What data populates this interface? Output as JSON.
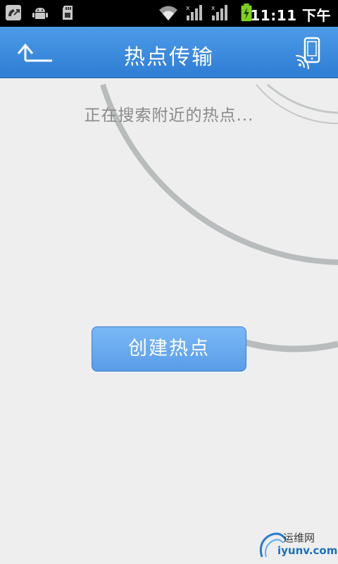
{
  "status_bar": {
    "time": "11:11 下午",
    "icons": [
      "missed-call-icon",
      "android-debug-icon",
      "sd-card-icon",
      "wifi-icon",
      "signal-icon",
      "signal-icon",
      "battery-charging-icon"
    ]
  },
  "header": {
    "title": "热点传输",
    "back_icon": "back-arrow-icon",
    "phone_icon": "phone-connect-icon",
    "background_color": "#3a8ade"
  },
  "main": {
    "status_text": "正在搜索附近的热点...",
    "create_button_label": "创建热点"
  },
  "watermark": {
    "line1": "运维网",
    "line2": "iyunv.com"
  },
  "colors": {
    "accent": "#5a9de8",
    "background": "#eeeeee",
    "status_text": "#8a8a8a",
    "radar_arc": "#b8bcbc"
  }
}
